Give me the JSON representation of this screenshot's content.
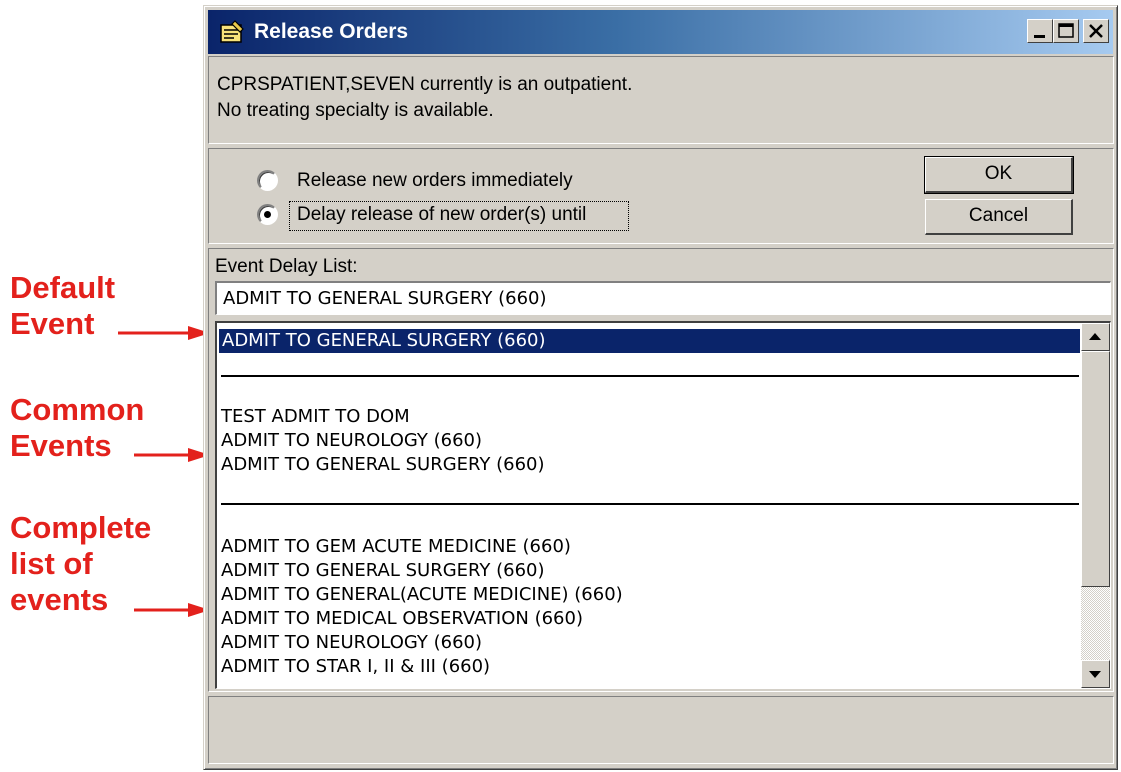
{
  "window": {
    "title": "Release Orders",
    "controls": [
      "minimize-icon",
      "maximize-icon",
      "close-icon"
    ]
  },
  "info": {
    "line1": "CPRSPATIENT,SEVEN currently is an outpatient.",
    "line2": "No treating specialty is available."
  },
  "options": {
    "release_immediately": {
      "label": "Release new orders immediately",
      "checked": false
    },
    "delay_release": {
      "label": "Delay release of new order(s) until",
      "checked": true
    }
  },
  "buttons": {
    "ok": "OK",
    "cancel": "Cancel"
  },
  "event_delay": {
    "label": "Event Delay List:",
    "value": "ADMIT TO GENERAL SURGERY (660)",
    "default_event": "ADMIT TO GENERAL SURGERY (660)",
    "common_events": [
      "TEST ADMIT TO DOM",
      "ADMIT TO NEUROLOGY (660)",
      "ADMIT TO GENERAL SURGERY (660)"
    ],
    "all_events": [
      "ADMIT TO GEM ACUTE MEDICINE (660)",
      "ADMIT TO GENERAL SURGERY (660)",
      "ADMIT TO GENERAL(ACUTE MEDICINE) (660)",
      "ADMIT TO MEDICAL OBSERVATION (660)",
      "ADMIT TO NEUROLOGY (660)",
      "ADMIT TO STAR I, II & III (660)"
    ]
  },
  "annotations": {
    "default_event": [
      "Default",
      "Event"
    ],
    "common_events": [
      "Common",
      "Events"
    ],
    "complete_list": [
      "Complete",
      "list of",
      "events"
    ]
  },
  "colors": {
    "annotation": "#e3211c",
    "selection": "#0a246a",
    "face": "#d4d0c8"
  }
}
